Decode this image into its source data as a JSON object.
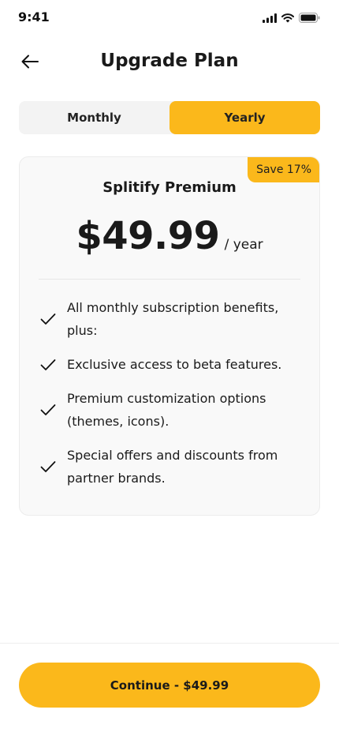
{
  "status_bar": {
    "time": "9:41",
    "icons": [
      "signal-icon",
      "wifi-icon",
      "battery-icon"
    ]
  },
  "header": {
    "title": "Upgrade Plan",
    "back_icon": "back-arrow-icon"
  },
  "billing_toggle": {
    "tabs": [
      {
        "label": "Monthly",
        "active": false
      },
      {
        "label": "Yearly",
        "active": true
      }
    ]
  },
  "plan": {
    "badge": "Save 17%",
    "name": "Splitify Premium",
    "price": "$49.99",
    "period": "/ year",
    "features": [
      {
        "text": "All monthly subscription benefits, plus:",
        "icon": "check-icon"
      },
      {
        "text": "Exclusive access to beta features.",
        "icon": "check-icon"
      },
      {
        "text": "Premium customization options (themes, icons).",
        "icon": "check-icon"
      },
      {
        "text": "Special offers and discounts from partner brands.",
        "icon": "check-icon"
      }
    ]
  },
  "footer": {
    "continue_label": "Continue - $49.99"
  },
  "colors": {
    "accent": "#fbb81b",
    "text": "#1a1a1a",
    "card_bg": "#f9f9f9",
    "toggle_bg": "#f3f3f3"
  }
}
